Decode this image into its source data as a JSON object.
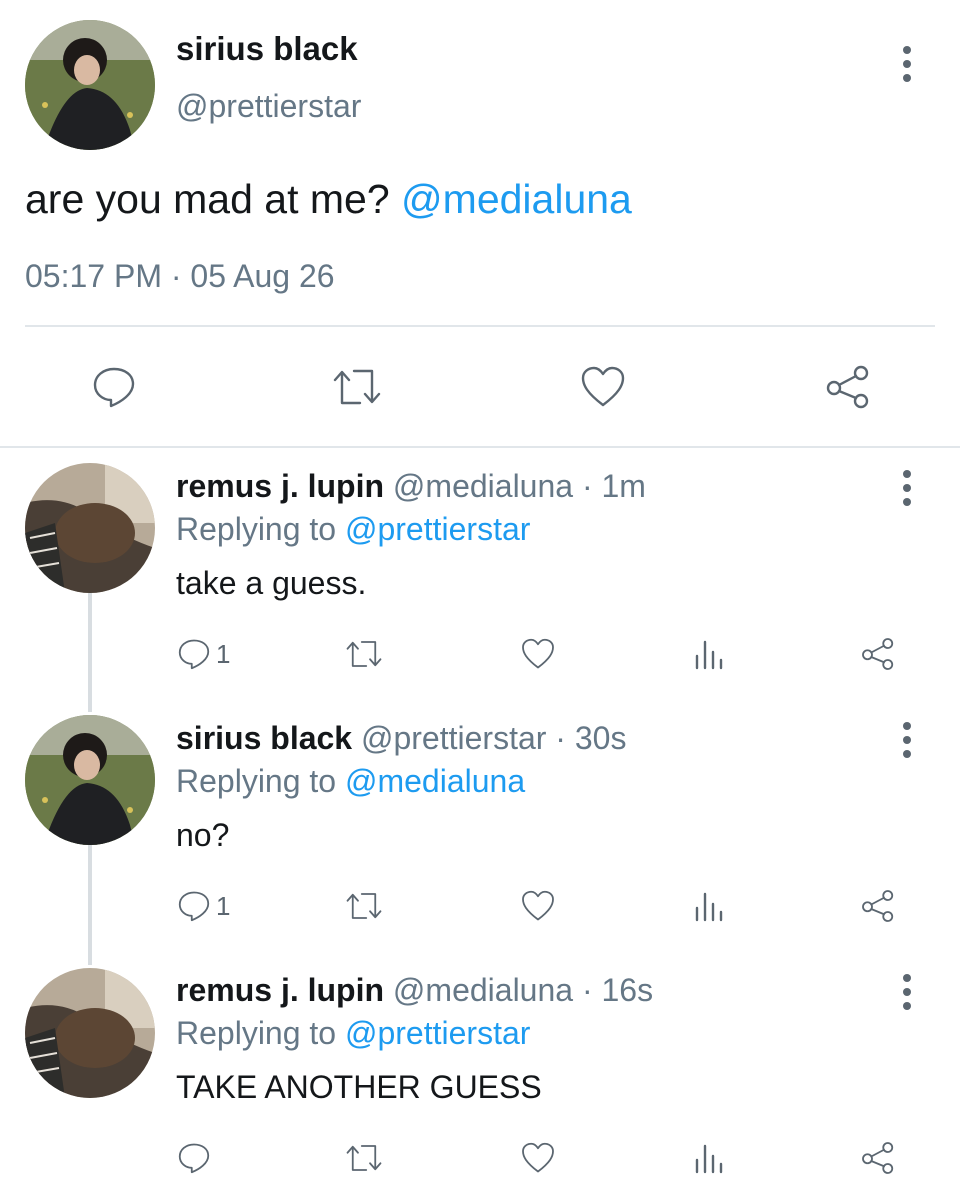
{
  "main_tweet": {
    "display_name": "sirius black",
    "handle": "@prettierstar",
    "text": "are you mad at me?",
    "mention": "@medialuna",
    "time": "05:17 PM",
    "separator": "·",
    "date": "05 Aug 26",
    "actions": [
      "reply-icon",
      "retweet-icon",
      "like-icon",
      "share-icon"
    ]
  },
  "replies": [
    {
      "display_name": "remus j. lupin",
      "handle": "@medialuna",
      "time": "· 1m",
      "replying_label": "Replying to",
      "replying_to": "@prettierstar",
      "text": "take a guess.",
      "reply_count": "1"
    },
    {
      "display_name": "sirius black",
      "handle": "@prettierstar",
      "time": "· 30s",
      "replying_label": "Replying to",
      "replying_to": "@medialuna",
      "text": "no?",
      "reply_count": "1"
    },
    {
      "display_name": "remus j. lupin",
      "handle": "@medialuna",
      "time": "· 16s",
      "replying_label": "Replying to",
      "replying_to": "@prettierstar",
      "text": "TAKE ANOTHER GUESS",
      "reply_count": ""
    }
  ],
  "colors": {
    "link": "#1d9bf0",
    "muted_text": "#657786",
    "icon": "#5b6670",
    "divider": "#e1e6ea"
  }
}
